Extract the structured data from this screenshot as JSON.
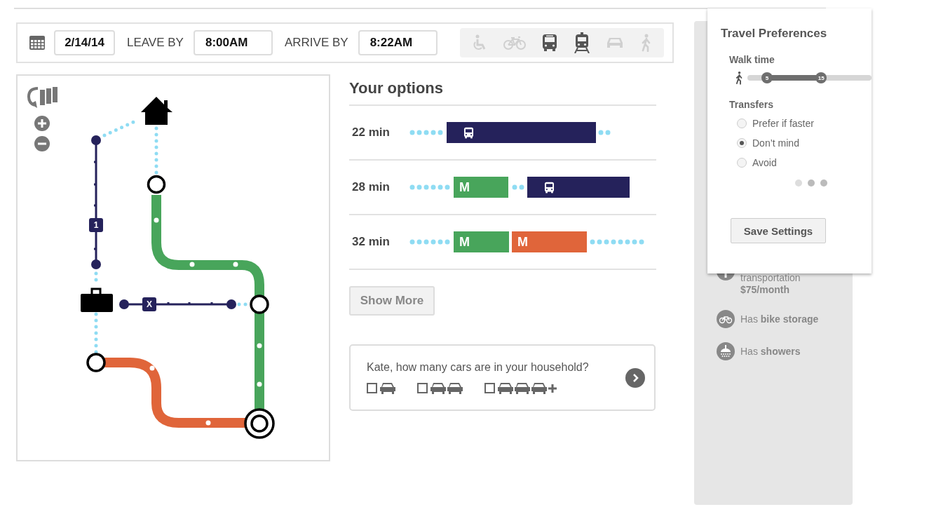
{
  "toolbar": {
    "date": "2/14/14",
    "leave_label": "LEAVE BY",
    "leave_time": "8:00AM",
    "arrive_label": "ARRIVE BY",
    "arrive_time": "8:22AM",
    "modes": [
      {
        "kind": "wheelchair",
        "on": false
      },
      {
        "kind": "bike",
        "on": false
      },
      {
        "kind": "bus",
        "on": true
      },
      {
        "kind": "train",
        "on": true
      },
      {
        "kind": "car",
        "on": false
      },
      {
        "kind": "walk",
        "on": false
      }
    ]
  },
  "map": {
    "route_badges": [
      "1",
      "X"
    ]
  },
  "options": {
    "title": "Your options",
    "rows": [
      {
        "duration": "22 min",
        "segments": [
          {
            "kind": "walk"
          },
          {
            "kind": "bus",
            "color": "#25225b"
          },
          {
            "kind": "walk"
          }
        ]
      },
      {
        "duration": "28 min",
        "segments": [
          {
            "kind": "walk"
          },
          {
            "kind": "metro",
            "label": "M",
            "color": "#48a55b"
          },
          {
            "kind": "walk"
          },
          {
            "kind": "bus",
            "color": "#25225b"
          }
        ]
      },
      {
        "duration": "32 min",
        "segments": [
          {
            "kind": "walk"
          },
          {
            "kind": "metro",
            "label": "M",
            "color": "#48a55b"
          },
          {
            "kind": "metro",
            "label": "M",
            "color": "#e0653a"
          },
          {
            "kind": "walk"
          }
        ]
      }
    ],
    "show_more": "Show More"
  },
  "question": {
    "text": "Kate, how many cars are in your household?",
    "choices": [
      {
        "kind": "one",
        "checked": false
      },
      {
        "kind": "two",
        "checked": false
      },
      {
        "kind": "three-plus",
        "checked": false
      }
    ]
  },
  "perks": [
    {
      "kind": "money",
      "lines": [
        {
          "text": "transportation",
          "bold": false
        },
        {
          "text": "$75/month",
          "bold": true
        }
      ]
    },
    {
      "kind": "bike",
      "lines": [
        {
          "text": "Has **bike storage**",
          "bold": false
        }
      ]
    },
    {
      "kind": "shower",
      "lines": [
        {
          "text": "Has **showers**",
          "bold": false
        }
      ]
    }
  ],
  "preferences": {
    "title": "Travel Preferences",
    "walk_label": "Walk time",
    "walk_thumbs": [
      {
        "label": "5",
        "level": 0.16
      },
      {
        "label": "15",
        "level": 0.595
      }
    ],
    "transfers_label": "Transfers",
    "transfer_options": [
      {
        "label": "Prefer if faster",
        "selected": false
      },
      {
        "label": "Don’t mind",
        "selected": true
      },
      {
        "label": "Avoid",
        "selected": false
      }
    ],
    "pager": [
      {
        "selected": true
      },
      {
        "selected": false
      },
      {
        "selected": false
      }
    ],
    "save": "Save Settings"
  }
}
